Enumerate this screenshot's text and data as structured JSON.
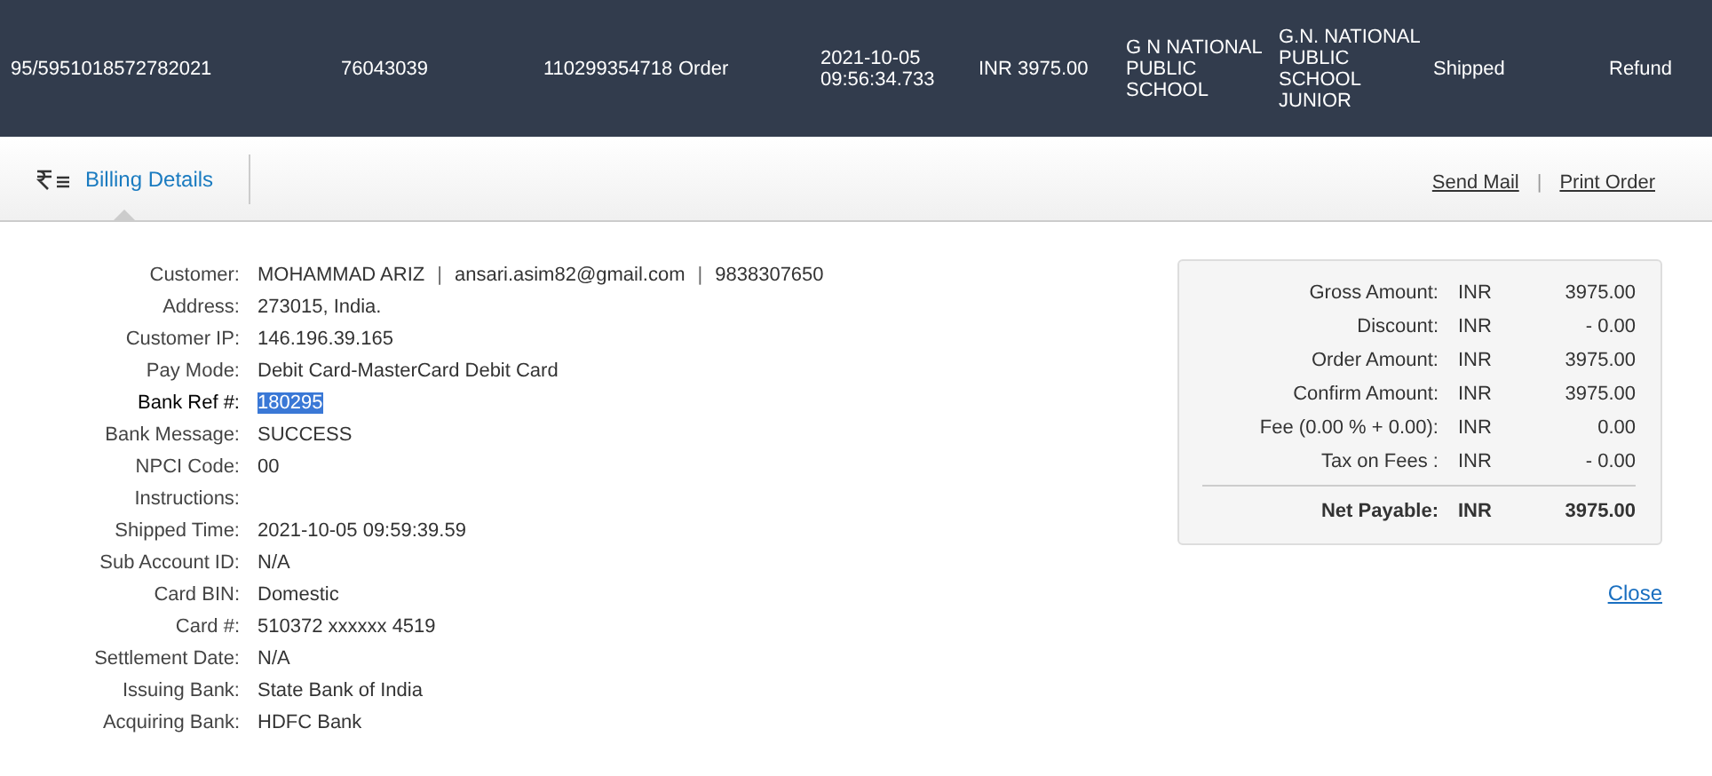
{
  "order_row": {
    "cells": [
      {
        "text": "95/5951018572782021"
      },
      {
        "text": "76043039"
      },
      {
        "text": "110299354718"
      },
      {
        "text": "Order"
      },
      {
        "text": "2021-10-05 09:56:34.733"
      },
      {
        "text": "INR 3975.00"
      },
      {
        "text": "G N NATIONAL PUBLIC SCHOOL"
      },
      {
        "text": "G.N. NATIONAL PUBLIC SCHOOL JUNIOR"
      },
      {
        "text": "Shipped"
      },
      {
        "text": "Refund"
      }
    ]
  },
  "tabs": [
    {
      "label": "Billing Details",
      "selected": true
    }
  ],
  "actions": [
    "Send Mail",
    "Print Order"
  ],
  "action_separator": "|",
  "details": [
    {
      "label": "Customer:",
      "parts": [
        "MOHAMMAD ARIZ",
        "ansari.asim82@gmail.com",
        "9838307650"
      ],
      "separator": "|",
      "highlighted": false
    },
    {
      "label": "Address:",
      "value": "273015, India.",
      "highlighted": false
    },
    {
      "label": "Customer IP:",
      "value": "146.196.39.165",
      "highlighted": false
    },
    {
      "label": "Pay Mode:",
      "value": "Debit Card-MasterCard Debit Card",
      "highlighted": false
    },
    {
      "label": "Bank Ref #:",
      "value": "180295",
      "highlighted": true
    },
    {
      "label": "Bank Message:",
      "value": "SUCCESS",
      "highlighted": false
    },
    {
      "label": "NPCI Code:",
      "value": "00",
      "highlighted": false
    },
    {
      "label": "Instructions:",
      "highlighted": false
    },
    {
      "label": "Shipped Time:",
      "value": "2021-10-05 09:59:39.59",
      "highlighted": false
    },
    {
      "label": "Sub Account ID:",
      "value": "N/A",
      "highlighted": false
    },
    {
      "label": "Card BIN:",
      "value": "Domestic",
      "highlighted": false
    },
    {
      "label": "Card #:",
      "value": "510372 xxxxxx 4519",
      "highlighted": false
    },
    {
      "label": "Settlement Date:",
      "value": "N/A",
      "highlighted": false
    },
    {
      "label": "Issuing Bank:",
      "value": "State Bank of India",
      "highlighted": false
    },
    {
      "label": "Acquiring Bank:",
      "value": "HDFC Bank",
      "highlighted": false
    }
  ],
  "summary": {
    "rows": [
      {
        "label": "Gross Amount:",
        "currency": "INR",
        "amount": "3975.00",
        "total": false
      },
      {
        "label": "Discount:",
        "currency": "INR",
        "amount": "- 0.00",
        "total": false
      },
      {
        "label": "Order Amount:",
        "currency": "INR",
        "amount": "3975.00",
        "total": false
      },
      {
        "label": "Confirm Amount:",
        "currency": "INR",
        "amount": "3975.00",
        "total": false
      },
      {
        "label": "Fee (0.00 % + 0.00):",
        "currency": "INR",
        "amount": "0.00",
        "total": false
      },
      {
        "label": "Tax on Fees :",
        "currency": "INR",
        "amount": "- 0.00",
        "total": false
      },
      {
        "label": "Net Payable:",
        "currency": "INR",
        "amount": "3975.00",
        "total": true
      }
    ]
  },
  "close_link": "Close"
}
